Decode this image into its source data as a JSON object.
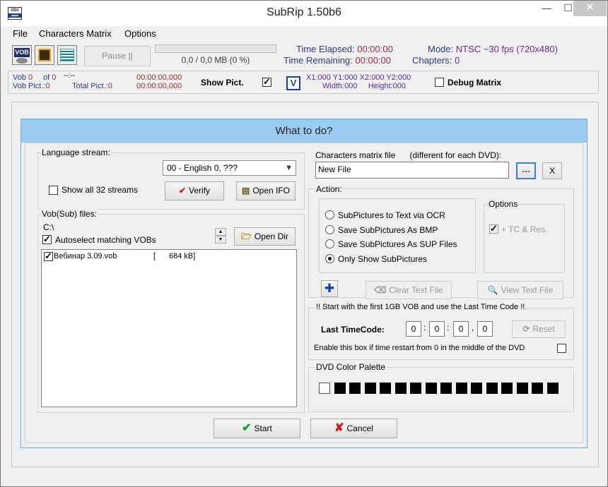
{
  "window": {
    "title": "SubRip 1.50b6",
    "controls": {
      "minimize": "—",
      "maximize": "☐",
      "close": "✕"
    }
  },
  "menu": {
    "items": [
      "File",
      "Characters Matrix",
      "Options"
    ]
  },
  "toolbar": {
    "pause_label": "Pause  ||",
    "progress_text": "0,0 / 0,0 MB (0 %)",
    "progress_fraction": 0,
    "time_elapsed_label": "Time Elapsed:",
    "time_elapsed_value": "00:00:00",
    "time_remaining_label": "Time Remaining:",
    "time_remaining_value": "00:00:00",
    "mode_label": "Mode:",
    "mode_value": "NTSC ~30 fps (720x480)",
    "chapters_label": "Chapters:",
    "chapters_value": "0",
    "icons": [
      "vob-icon",
      "film-icon",
      "text-matrix-icon"
    ]
  },
  "info": {
    "vob_label": "Vob",
    "vob_value": "0",
    "of_label": "of",
    "of_value": "0",
    "dash": "--:--",
    "vob_pict_label": "Vob Pict.:",
    "vob_pict_value": "0",
    "total_pict_label": "Total Pict.:",
    "total_pict_value": "0",
    "time1": "00:00:00,000",
    "time2": "00:00:00,000",
    "show_pict_label": "Show Pict.",
    "show_pict_checked": true,
    "v_label": "V",
    "x1_label": "X1:",
    "x1_value": "000",
    "y1_label": "Y1:",
    "y1_value": "000",
    "x2_label": "X2:",
    "x2_value": "000",
    "y2_label": "Y2:",
    "y2_value": "000",
    "width_label": "Width:",
    "width_value": "000",
    "height_label": "Height:",
    "height_value": "000",
    "debug_matrix_label": "Debug Matrix",
    "debug_matrix_checked": false
  },
  "dialog": {
    "title": "What to do?",
    "language": {
      "label": "Language stream:",
      "selected": "00 - English 0, ???",
      "show_all_label": "Show all 32 streams",
      "show_all_checked": false,
      "verify_label": "Verify",
      "open_ifo_label": "Open IFO"
    },
    "vob_files": {
      "label": "Vob(Sub) files:",
      "path": "C:\\",
      "autoselect_label": "Autoselect matching VOBs",
      "autoselect_checked": true,
      "open_dir_label": "Open Dir",
      "files": [
        {
          "name": "Вебинар 3.09.vob",
          "bracket": "[",
          "size": "684 kB]",
          "checked": true
        }
      ]
    },
    "matrix": {
      "label": "Characters matrix file",
      "hint": "(different for each DVD):",
      "value": "New File",
      "browse_label": "---",
      "clear_label": "X"
    },
    "action": {
      "label": "Action:",
      "options": [
        {
          "label": "SubPictures to Text via OCR",
          "selected": false
        },
        {
          "label": "Save SubPictures As BMP",
          "selected": false
        },
        {
          "label": "Save SubPictures As SUP Files",
          "selected": false
        },
        {
          "label": "Only Show SubPictures",
          "selected": true
        }
      ],
      "clear_text_file_label": "Clear Text File",
      "view_text_file_label": "View Text File"
    },
    "options": {
      "label": "Options",
      "tc_res_label": "+ TC & Res.",
      "tc_res_checked": true
    },
    "timecode": {
      "warning": "!! Start with the first 1GB VOB and use the Last Time Code !!",
      "last_timecode_label": "Last TimeCode:",
      "fields": [
        "0",
        "0",
        "0",
        "0"
      ],
      "separators": [
        ":",
        ":",
        ","
      ],
      "reset_label": "Reset",
      "restart_label": "Enable this box if time restart from 0 in the middle of the DVD",
      "restart_checked": false
    },
    "palette": {
      "label": "DVD Color Palette",
      "colors": [
        "#ffffff",
        "#000000",
        "#000000",
        "#000000",
        "#000000",
        "#000000",
        "#000000",
        "#000000",
        "#000000",
        "#000000",
        "#000000",
        "#000000",
        "#000000",
        "#000000",
        "#000000",
        "#000000"
      ]
    },
    "start_label": "Start",
    "cancel_label": "Cancel"
  }
}
